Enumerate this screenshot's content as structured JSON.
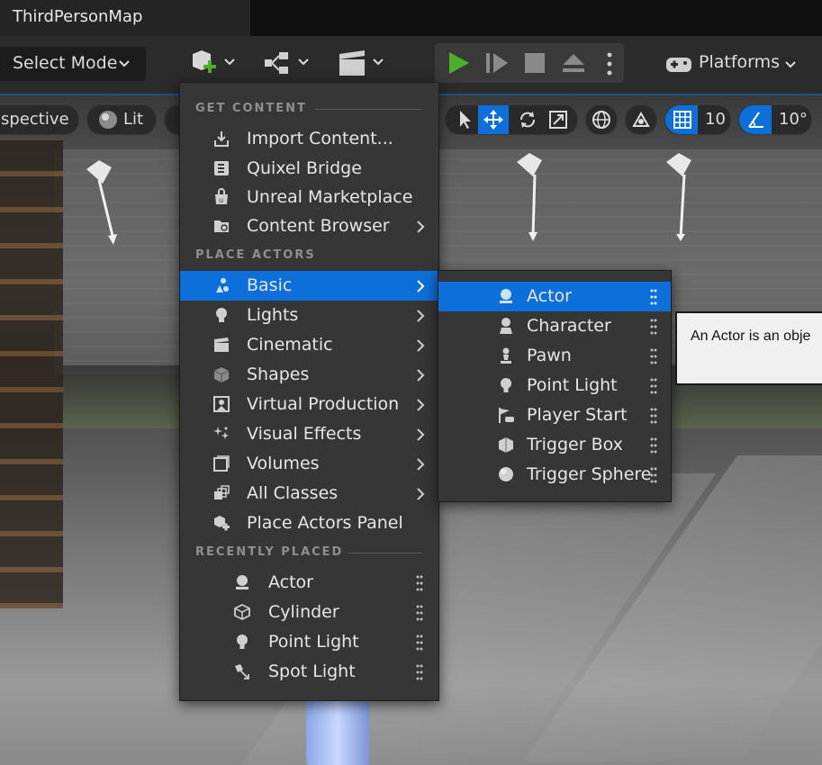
{
  "window": {
    "tab_title": "ThirdPersonMap"
  },
  "toolbar": {
    "select_mode": "Select Mode",
    "platforms": "Platforms"
  },
  "viewport": {
    "perspective_label": "spective",
    "lit_label": "Lit",
    "grid_snap": "10",
    "rotation_snap": "10°"
  },
  "place_menu": {
    "sections": {
      "get_content": "GET CONTENT",
      "place_actors": "PLACE ACTORS",
      "recently_placed": "RECENTLY PLACED"
    },
    "get_content_items": [
      {
        "label": "Import Content...",
        "icon": "import-icon"
      },
      {
        "label": "Quixel Bridge",
        "icon": "quixel-bridge-icon"
      },
      {
        "label": "Unreal Marketplace",
        "icon": "marketplace-icon"
      },
      {
        "label": "Content Browser",
        "icon": "content-browser-icon",
        "has_submenu": true
      }
    ],
    "place_actor_items": [
      {
        "label": "Basic",
        "icon": "basic-actors-icon",
        "has_submenu": true,
        "active": true
      },
      {
        "label": "Lights",
        "icon": "light-bulb-icon",
        "has_submenu": true
      },
      {
        "label": "Cinematic",
        "icon": "clapperboard-icon",
        "has_submenu": true
      },
      {
        "label": "Shapes",
        "icon": "cube-icon",
        "has_submenu": true
      },
      {
        "label": "Virtual Production",
        "icon": "virtual-production-icon",
        "has_submenu": true
      },
      {
        "label": "Visual Effects",
        "icon": "sparkles-icon",
        "has_submenu": true
      },
      {
        "label": "Volumes",
        "icon": "volume-icon",
        "has_submenu": true
      },
      {
        "label": "All Classes",
        "icon": "all-classes-icon",
        "has_submenu": true
      },
      {
        "label": "Place Actors Panel",
        "icon": "place-actors-icon"
      }
    ],
    "recent_items": [
      {
        "label": "Actor",
        "icon": "actor-icon"
      },
      {
        "label": "Cylinder",
        "icon": "cylinder-icon"
      },
      {
        "label": "Point Light",
        "icon": "point-light-icon"
      },
      {
        "label": "Spot Light",
        "icon": "spot-light-icon"
      }
    ]
  },
  "basic_submenu": {
    "items": [
      {
        "label": "Actor",
        "icon": "actor-icon",
        "active": true
      },
      {
        "label": "Character",
        "icon": "character-icon"
      },
      {
        "label": "Pawn",
        "icon": "pawn-icon"
      },
      {
        "label": "Point Light",
        "icon": "point-light-icon"
      },
      {
        "label": "Player Start",
        "icon": "player-start-icon"
      },
      {
        "label": "Trigger Box",
        "icon": "trigger-box-icon"
      },
      {
        "label": "Trigger Sphere",
        "icon": "trigger-sphere-icon"
      }
    ]
  },
  "tooltip": {
    "text": "An Actor is an obje"
  },
  "colors": {
    "accent": "#0d6fd9",
    "play_green": "#4caf2a",
    "menu_bg": "#363636"
  }
}
